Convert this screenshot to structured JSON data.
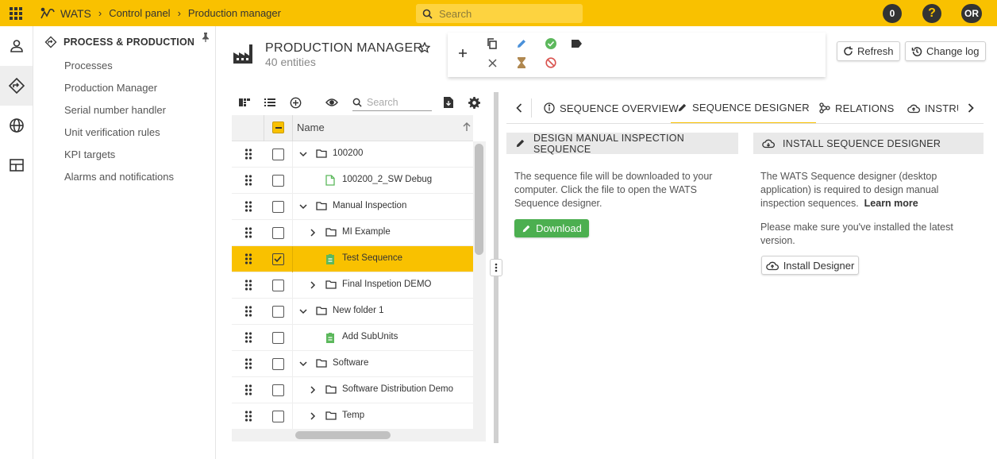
{
  "topbar": {
    "brand": "WATS",
    "breadcrumbs": [
      "Control panel",
      "Production manager"
    ],
    "search_placeholder": "Search",
    "notification_count": "0",
    "help_label": "?",
    "avatar_initials": "OR",
    "bg_color": "#f9c100"
  },
  "sidebar": {
    "title": "PROCESS & PRODUCTION",
    "items": [
      "Processes",
      "Production Manager",
      "Serial number handler",
      "Unit verification rules",
      "KPI targets",
      "Alarms and notifications"
    ]
  },
  "header": {
    "title": "PRODUCTION MANAGER",
    "entity_count": "40 entities",
    "refresh_label": "Refresh",
    "changelog_label": "Change log"
  },
  "tree": {
    "search_placeholder": "Search",
    "column_name": "Name",
    "rows": [
      {
        "label": "100200",
        "type": "folder",
        "level": 0,
        "expander": "expanded",
        "checked": false,
        "selected": false
      },
      {
        "label": "100200_2_SW Debug",
        "type": "file",
        "level": 1,
        "expander": "none",
        "checked": false,
        "selected": false
      },
      {
        "label": "Manual Inspection",
        "type": "folder",
        "level": 0,
        "expander": "expanded",
        "checked": false,
        "selected": false
      },
      {
        "label": "MI Example",
        "type": "folder",
        "level": 1,
        "expander": "collapsed",
        "checked": false,
        "selected": false
      },
      {
        "label": "Test Sequence",
        "type": "sequence",
        "level": 1,
        "expander": "none",
        "checked": true,
        "selected": true
      },
      {
        "label": "Final Inspetion DEMO",
        "type": "folder",
        "level": 1,
        "expander": "collapsed",
        "checked": false,
        "selected": false
      },
      {
        "label": "New folder 1",
        "type": "folder",
        "level": 0,
        "expander": "expanded",
        "checked": false,
        "selected": false
      },
      {
        "label": "Add SubUnits",
        "type": "sequence",
        "level": 1,
        "expander": "none",
        "checked": false,
        "selected": false
      },
      {
        "label": "Software",
        "type": "folder",
        "level": 0,
        "expander": "expanded",
        "checked": false,
        "selected": false
      },
      {
        "label": "Software Distribution Demo",
        "type": "folder",
        "level": 1,
        "expander": "collapsed",
        "checked": false,
        "selected": false
      },
      {
        "label": "Temp",
        "type": "folder",
        "level": 1,
        "expander": "collapsed",
        "checked": false,
        "selected": false
      }
    ]
  },
  "tabs": {
    "items": [
      "SEQUENCE OVERVIEW",
      "SEQUENCE DESIGNER",
      "RELATIONS",
      "INSTRUCTIONS"
    ],
    "active": "SEQUENCE DESIGNER"
  },
  "design_card": {
    "title": "DESIGN MANUAL INSPECTION SEQUENCE",
    "line1": "The sequence file will be downloaded to your",
    "line2": "computer. Click the file to open the WATS",
    "line3": "Sequence designer.",
    "button": "Download"
  },
  "install_card": {
    "title": "INSTALL SEQUENCE DESIGNER",
    "line1": "The WATS Sequence designer (desktop",
    "line2": "application) is required to design manual",
    "line3": "inspection sequences.",
    "learn_more": "Learn more",
    "line4": "Please make sure you've installed the latest",
    "line5": "version.",
    "button": "Install Designer"
  },
  "colors": {
    "accent": "#f9c100",
    "success": "#4caf50",
    "file_green": "#5cb85c",
    "edit_blue": "#4a90d9",
    "cancel_red": "#d9534f",
    "hourglass": "#b08850"
  }
}
